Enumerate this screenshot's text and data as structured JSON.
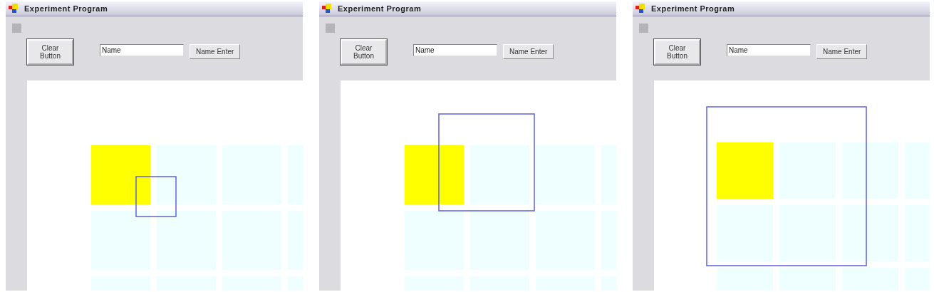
{
  "windows": [
    {
      "title": "Experiment Program",
      "clear_button": "Clear Button",
      "name_field": {
        "value": "Name"
      },
      "enter_button": "Name Enter",
      "tiles": [
        {
          "selected": true
        },
        {
          "selected": false
        },
        {
          "selected": false
        },
        {
          "selected": false
        },
        {
          "selected": false
        },
        {
          "selected": false
        },
        {
          "selected": false
        },
        {
          "selected": false
        },
        {
          "selected": false
        },
        {
          "selected": false
        },
        {
          "selected": false
        },
        {
          "selected": false
        }
      ]
    },
    {
      "title": "Experiment Program",
      "clear_button": "Clear Button",
      "name_field": {
        "value": "Name"
      },
      "enter_button": "Name Enter",
      "tiles": [
        {
          "selected": true
        },
        {
          "selected": false
        },
        {
          "selected": false
        },
        {
          "selected": false
        },
        {
          "selected": false
        },
        {
          "selected": false
        },
        {
          "selected": false
        },
        {
          "selected": false
        },
        {
          "selected": false
        },
        {
          "selected": false
        },
        {
          "selected": false
        },
        {
          "selected": false
        }
      ]
    },
    {
      "title": "Experiment Program",
      "clear_button": "Clear Button",
      "name_field": {
        "value": "Name"
      },
      "enter_button": "Name Enter",
      "tiles": [
        {
          "selected": true
        },
        {
          "selected": false
        },
        {
          "selected": false
        },
        {
          "selected": false
        },
        {
          "selected": false
        },
        {
          "selected": false
        },
        {
          "selected": false
        },
        {
          "selected": false
        },
        {
          "selected": false
        },
        {
          "selected": false
        },
        {
          "selected": false
        },
        {
          "selected": false
        }
      ]
    }
  ]
}
